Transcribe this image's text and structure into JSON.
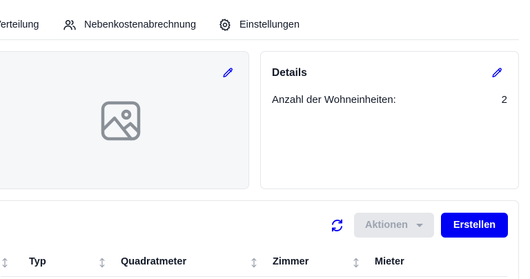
{
  "tabs": [
    {
      "label": "Verteilung",
      "icon": "distribution-icon"
    },
    {
      "label": "Nebenkostenabrechnung",
      "icon": "users-icon"
    },
    {
      "label": "Einstellungen",
      "icon": "gear-icon"
    }
  ],
  "image_card": {
    "edit_icon": "pencil-icon",
    "image_icon": "image-placeholder-icon"
  },
  "details": {
    "title": "Details",
    "label": "Anzahl der Wohneinheiten:",
    "value": "2",
    "edit_icon": "pencil-icon"
  },
  "toolbar": {
    "refresh_icon": "refresh-icon",
    "actions_label": "Aktionen",
    "create_label": "Erstellen"
  },
  "table": {
    "columns": [
      "Typ",
      "Quadratmeter",
      "Zimmer",
      "Mieter"
    ]
  },
  "colors": {
    "accent": "#0000f5",
    "disabled_bg": "#e5e7eb",
    "disabled_text": "#9ca3af",
    "border": "#e5e7eb",
    "image_bg": "#f6f7f9"
  }
}
